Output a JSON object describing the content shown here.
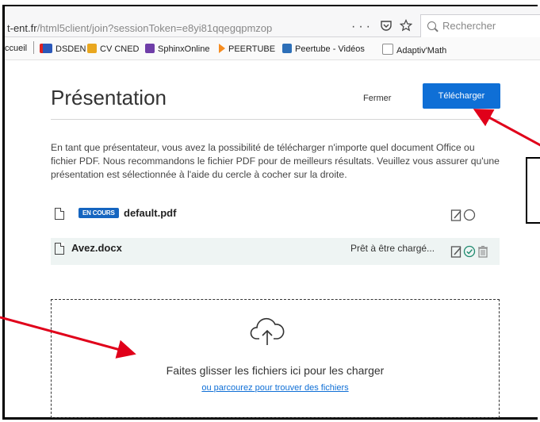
{
  "browser": {
    "url_domain": "t-ent.fr",
    "url_path": "/html5client/join?sessionToken=e8yi81qqegqpmzop",
    "menu_icon": "more-icon",
    "pocket_icon": "pocket-icon",
    "star_icon": "star-icon",
    "search_placeholder": "Rechercher"
  },
  "bookmarks": [
    {
      "label": "ccueil",
      "icon": "",
      "color": ""
    },
    {
      "label": "DSDEN",
      "icon": "dsden-icon",
      "color": "#2b58b9"
    },
    {
      "label": "CV CNED",
      "icon": "cned-icon",
      "color": "#e9a71f"
    },
    {
      "label": "SphinxOnline",
      "icon": "sphinx-icon",
      "color": "#6f3ea8"
    },
    {
      "label": "PEERTUBE",
      "icon": "peertube-icon",
      "color": "#f68c1f"
    },
    {
      "label": "Peertube - Vidéos",
      "icon": "peertube-videos-icon",
      "color": "#2d6fb8"
    },
    {
      "label": "Adaptiv'Math",
      "icon": "adaptivmath-icon",
      "color": "#8d8d8d"
    }
  ],
  "dialog": {
    "title": "Présentation",
    "close_label": "Fermer",
    "upload_label": "Télécharger",
    "description": "En tant que présentateur, vous avez la possibilité de télécharger n'importe quel document Office ou fichier PDF. Nous recommandons le fichier PDF pour de meilleurs résultats. Veuillez vous assurer qu'une présentation est sélectionnée à l'aide du cercle à cocher sur la droite.",
    "files": [
      {
        "name": "default.pdf",
        "badge": "EN COURS",
        "status": ""
      },
      {
        "name": "Avez.docx",
        "badge": "",
        "status": "Prêt à être chargé..."
      }
    ],
    "dropzone_text": "Faites glisser les fichiers ici pour les charger",
    "browse_link": "ou parcourez pour trouver des fichiers"
  },
  "colors": {
    "accent": "#0f6fd6",
    "badge": "#1565c0",
    "arrow": "#e0001a",
    "selected_row": "#eef4f3"
  }
}
